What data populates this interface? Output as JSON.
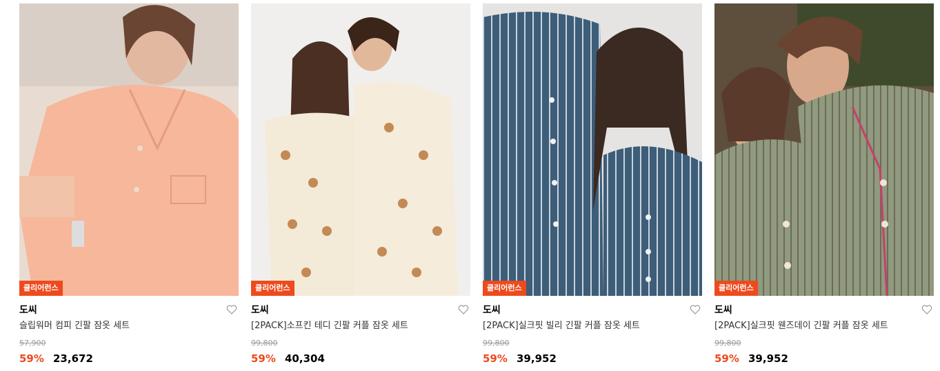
{
  "products": [
    {
      "badge": "클리어런스",
      "brand": "도씨",
      "name": "슬립워머 컴피 긴팔 잠옷 세트",
      "original_price": "57,900",
      "discount": "59%",
      "price": "23,672",
      "image_icon": "product-photo-icon",
      "colors": {
        "bg": "#e9ddd3",
        "garment": "#f6b79a"
      }
    },
    {
      "badge": "클리어런스",
      "brand": "도씨",
      "name": "[2PACK]소프킨 테디 긴팔 커플 잠옷 세트",
      "original_price": "99,800",
      "discount": "59%",
      "price": "40,304",
      "image_icon": "product-photo-icon",
      "colors": {
        "bg": "#f1f0ee",
        "garment": "#f4ead8"
      }
    },
    {
      "badge": "클리어런스",
      "brand": "도씨",
      "name": "[2PACK]실크핏 빌리 긴팔 커플 잠옷 세트",
      "original_price": "99,800",
      "discount": "59%",
      "price": "39,952",
      "image_icon": "product-photo-icon",
      "colors": {
        "bg": "#e8e6e4",
        "garment": "#3f5f7a"
      }
    },
    {
      "badge": "클리어런스",
      "brand": "도씨",
      "name": "[2PACK]실크핏 웬즈데이 긴팔 커플 잠옷 세트",
      "original_price": "99,800",
      "discount": "59%",
      "price": "39,952",
      "image_icon": "product-photo-icon",
      "colors": {
        "bg": "#6b5a45",
        "garment": "#8e9a7c"
      }
    }
  ],
  "accent_color": "#ee4a1d",
  "wishlist_icon": "heart-outline-icon"
}
